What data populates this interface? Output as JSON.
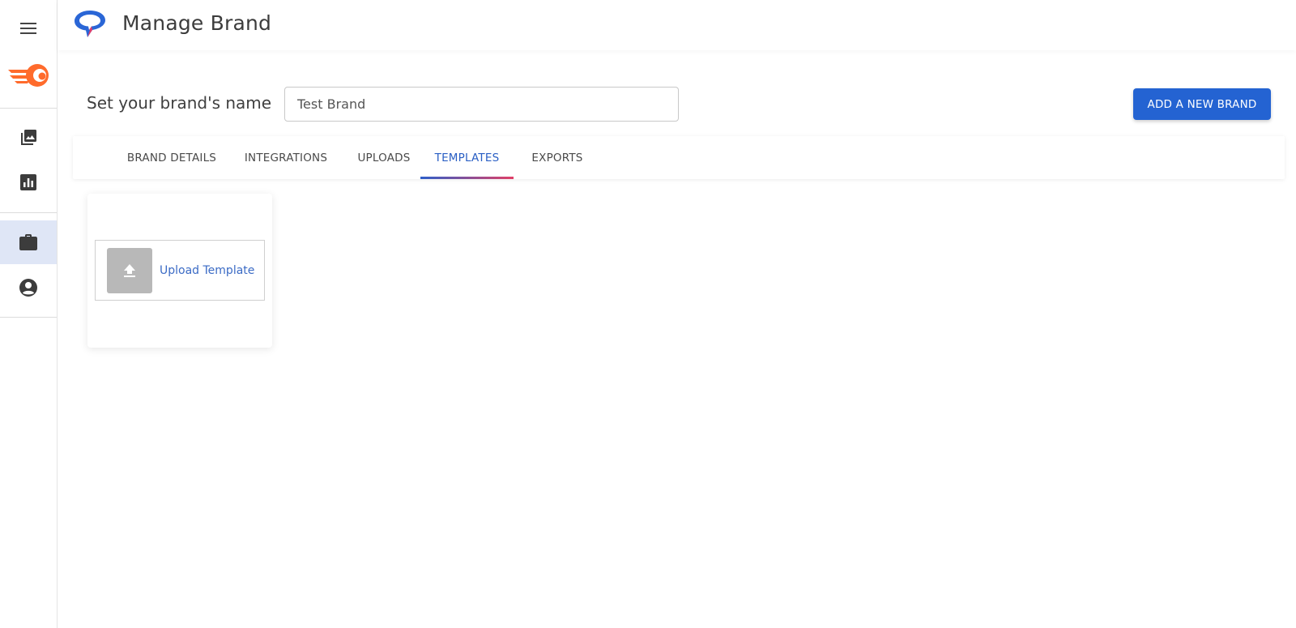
{
  "header": {
    "title": "Manage Brand",
    "logo_icon": "chat-bubble-logo-icon"
  },
  "sidebar": {
    "items": [
      {
        "name": "menu",
        "icon": "hamburger-menu-icon"
      },
      {
        "name": "brand-logo",
        "icon": "fire-ball-logo-icon"
      },
      {
        "name": "gallery",
        "icon": "image-gallery-icon"
      },
      {
        "name": "analytics",
        "icon": "bar-chart-icon"
      },
      {
        "name": "brands",
        "icon": "briefcase-icon",
        "active": true
      },
      {
        "name": "account",
        "icon": "account-circle-icon"
      }
    ]
  },
  "brand_form": {
    "label": "Set your brand's name",
    "input_value": "Test Brand",
    "add_button_label": "ADD A NEW BRAND"
  },
  "tabs": [
    {
      "label": "BRAND DETAILS",
      "active": false
    },
    {
      "label": "INTEGRATIONS",
      "active": false
    },
    {
      "label": "UPLOADS",
      "active": false
    },
    {
      "label": "TEMPLATES",
      "active": true
    },
    {
      "label": "EXPORTS",
      "active": false
    }
  ],
  "templates": {
    "upload_label": "Upload Template",
    "upload_icon": "upload-arrow-icon"
  },
  "colors": {
    "accent": "#2463d2",
    "active_tab_text": "#2a5fc4",
    "indicator_start": "#2e5fc9",
    "indicator_end": "#e04067",
    "sidebar_active_bg": "#dfe6f6"
  }
}
